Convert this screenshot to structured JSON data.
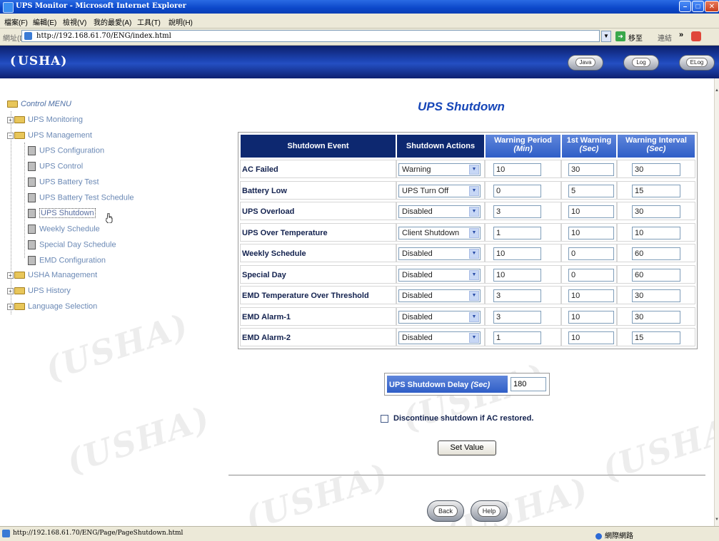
{
  "window": {
    "title": "UPS Monitor - Microsoft Internet Explorer",
    "minimize": "–",
    "maximize": "□",
    "close": "✕"
  },
  "menu": [
    "檔案(F)",
    "編輯(E)",
    "檢視(V)",
    "我的最愛(A)",
    "工具(T)",
    "說明(H)"
  ],
  "address": {
    "label": "網址(D)",
    "url": "http://192.168.61.70/ENG/index.html",
    "go_label": "移至",
    "links_label": "連結",
    "chevron": "»"
  },
  "header": {
    "logo": "USHA",
    "buttons": [
      "Java",
      "Log",
      "ELog"
    ]
  },
  "tree": {
    "root": "Control MENU",
    "items": [
      {
        "label": "UPS Monitoring",
        "type": "folder"
      },
      {
        "label": "UPS Management",
        "type": "folder-open"
      },
      {
        "label": "UPS Configuration",
        "type": "doc"
      },
      {
        "label": "UPS Control",
        "type": "doc"
      },
      {
        "label": "UPS Battery Test",
        "type": "doc"
      },
      {
        "label": "UPS Battery Test Schedule",
        "type": "doc"
      },
      {
        "label": "UPS Shutdown",
        "type": "doc",
        "current": true
      },
      {
        "label": "Weekly Schedule",
        "type": "doc"
      },
      {
        "label": "Special Day Schedule",
        "type": "doc"
      },
      {
        "label": "EMD Configuration",
        "type": "doc"
      },
      {
        "label": "USHA Management",
        "type": "folder"
      },
      {
        "label": "UPS History",
        "type": "folder"
      },
      {
        "label": "Language Selection",
        "type": "folder"
      }
    ]
  },
  "page": {
    "title": "UPS Shutdown",
    "columns": [
      {
        "label": "Shutdown Event",
        "sub": ""
      },
      {
        "label": "Shutdown Actions",
        "sub": ""
      },
      {
        "label": "Warning Period",
        "sub": "(Min)"
      },
      {
        "label": "1st Warning",
        "sub": "(Sec)"
      },
      {
        "label": "Warning Interval",
        "sub": "(Sec)"
      }
    ],
    "rows": [
      {
        "event": "AC Failed",
        "action": "Warning",
        "period": "10",
        "first": "30",
        "interval": "30"
      },
      {
        "event": "Battery Low",
        "action": "UPS Turn Off",
        "period": "0",
        "first": "5",
        "interval": "15"
      },
      {
        "event": "UPS Overload",
        "action": "Disabled",
        "period": "3",
        "first": "10",
        "interval": "30"
      },
      {
        "event": "UPS Over Temperature",
        "action": "Client Shutdown",
        "period": "1",
        "first": "10",
        "interval": "10"
      },
      {
        "event": "Weekly Schedule",
        "action": "Disabled",
        "period": "10",
        "first": "0",
        "interval": "60"
      },
      {
        "event": "Special Day",
        "action": "Disabled",
        "period": "10",
        "first": "0",
        "interval": "60"
      },
      {
        "event": "EMD Temperature Over Threshold",
        "action": "Disabled",
        "period": "3",
        "first": "10",
        "interval": "30"
      },
      {
        "event": "EMD Alarm-1",
        "action": "Disabled",
        "period": "3",
        "first": "10",
        "interval": "30"
      },
      {
        "event": "EMD Alarm-2",
        "action": "Disabled",
        "period": "1",
        "first": "10",
        "interval": "15"
      }
    ],
    "delay": {
      "label": "UPS Shutdown Delay",
      "unit": "(Sec)",
      "value": "180"
    },
    "discontinue_label": "Discontinue shutdown if AC restored.",
    "discontinue_checked": false,
    "set_value_label": "Set Value",
    "back_label": "Back",
    "help_label": "Help"
  },
  "status": {
    "url": "http://192.168.61.70/ENG/Page/PageShutdown.html",
    "zone": "網際網路"
  }
}
